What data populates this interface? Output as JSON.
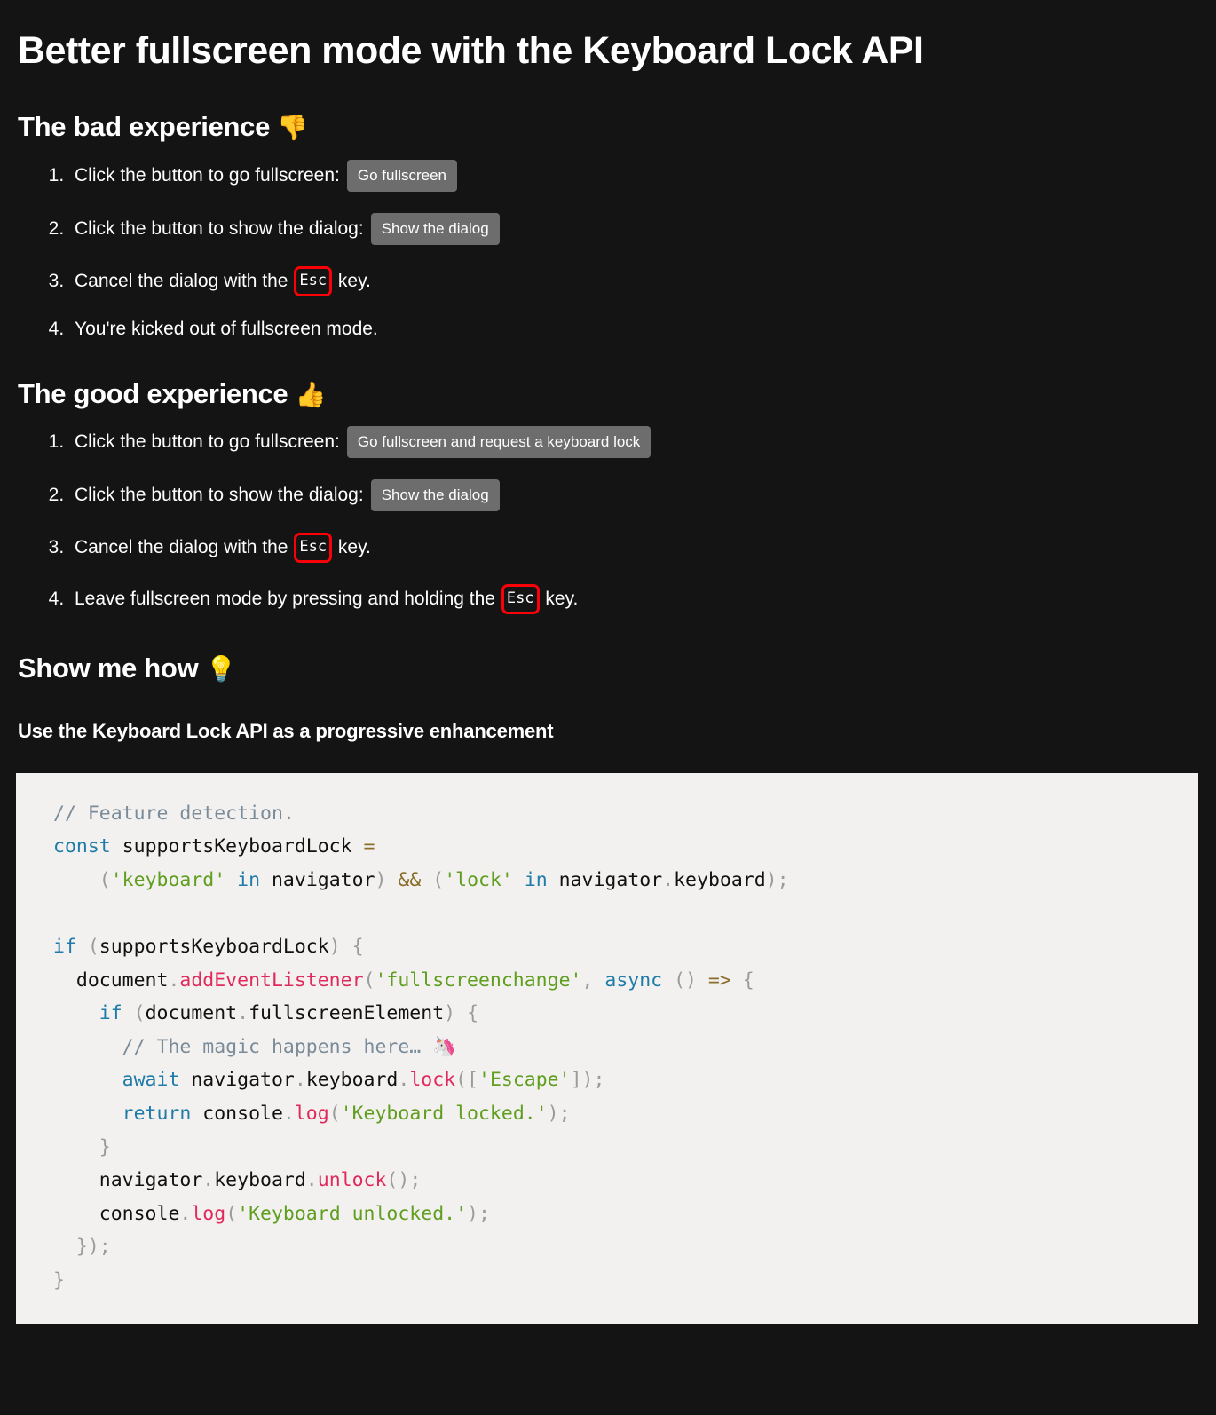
{
  "page": {
    "title": "Better fullscreen mode with the Keyboard Lock API",
    "background_color": "#141414",
    "text_color": "#ffffff"
  },
  "sections": {
    "bad": {
      "heading": "The bad experience",
      "heading_emoji": "👎",
      "steps": [
        {
          "text_before": "Click the button to go fullscreen:",
          "button": "Go fullscreen",
          "text_after": ""
        },
        {
          "text_before": "Click the button to show the dialog:",
          "button": "Show the dialog",
          "text_after": ""
        },
        {
          "text_before": "Cancel the dialog with the",
          "kbd": "Esc",
          "text_after": "key."
        },
        {
          "text_before": "You're kicked out of fullscreen mode.",
          "text_after": ""
        }
      ]
    },
    "good": {
      "heading": "The good experience",
      "heading_emoji": "👍",
      "steps": [
        {
          "text_before": "Click the button to go fullscreen:",
          "button": "Go fullscreen and request a keyboard lock",
          "text_after": ""
        },
        {
          "text_before": "Click the button to show the dialog:",
          "button": "Show the dialog",
          "text_after": ""
        },
        {
          "text_before": "Cancel the dialog with the",
          "kbd": "Esc",
          "text_after": "key."
        },
        {
          "text_before": "Leave fullscreen mode by pressing and holding the",
          "kbd": "Esc",
          "text_after": "key."
        }
      ]
    },
    "how": {
      "heading": "Show me how",
      "heading_emoji": "💡",
      "sub_heading": "Use the Keyboard Lock API as a progressive enhancement"
    }
  },
  "code": {
    "language": "javascript",
    "background_color": "#f2f1ef",
    "lines": [
      "// Feature detection.",
      "const supportsKeyboardLock =",
      "    ('keyboard' in navigator) && ('lock' in navigator.keyboard);",
      "",
      "if (supportsKeyboardLock) {",
      "  document.addEventListener('fullscreenchange', async () => {",
      "    if (document.fullscreenElement) {",
      "      // The magic happens here… 🦄",
      "      await navigator.keyboard.lock(['Escape']);",
      "      return console.log('Keyboard locked.');",
      "    }",
      "    navigator.keyboard.unlock();",
      "    console.log('Keyboard unlocked.');",
      "  });",
      "}"
    ],
    "colors": {
      "comment": "#7a8b99",
      "keyword": "#1f7ba8",
      "operator": "#8a6d2a",
      "string": "#5f9e1e",
      "function": "#e0295c",
      "punctuation": "#9b9b9b",
      "plain": "#111111"
    }
  },
  "styles": {
    "button_bg": "#6d6d6d",
    "kbd_border": "#fb0007"
  }
}
